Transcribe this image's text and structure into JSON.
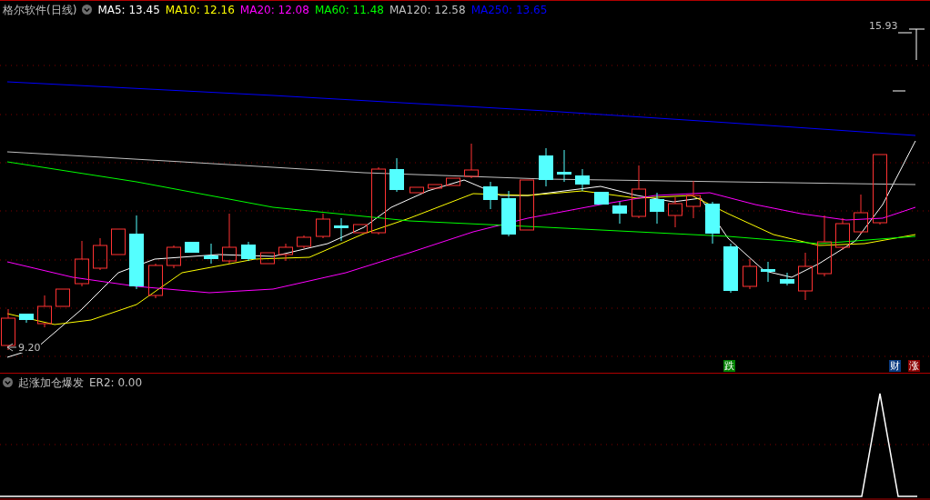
{
  "header": {
    "title": "格尔软件(日线)",
    "indicators": [
      {
        "label": "MA5: 13.45",
        "color": "#ffffff"
      },
      {
        "label": "MA10: 12.16",
        "color": "#ffff00"
      },
      {
        "label": "MA20: 12.08",
        "color": "#ff00ff"
      },
      {
        "label": "MA60: 11.48",
        "color": "#00ff00"
      },
      {
        "label": "MA120: 12.58",
        "color": "#c0c0c0"
      },
      {
        "label": "MA250: 13.65",
        "color": "#0000ff"
      }
    ]
  },
  "main_chart": {
    "high_label": "15.93",
    "low_label": "9.20",
    "signals": [
      {
        "text": "跌",
        "color": "#008000"
      },
      {
        "text": "财",
        "color": "#0a3c82"
      },
      {
        "text": "涨",
        "color": "#8b0000"
      }
    ]
  },
  "sub_panel": {
    "title": "起涨加仓爆发",
    "reading": "ER2: 0.00"
  }
}
